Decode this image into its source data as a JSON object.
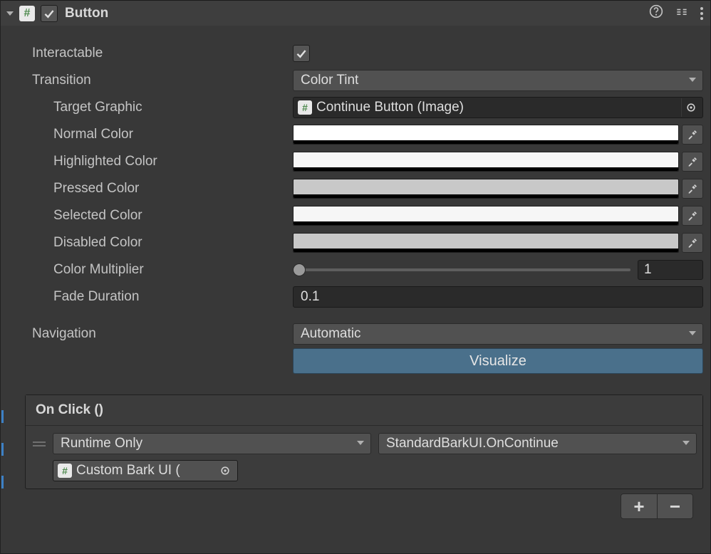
{
  "header": {
    "title": "Button",
    "enabled": true
  },
  "icons": {
    "help": "help-icon",
    "preset": "preset-icon",
    "menu": "kebab-icon"
  },
  "fields": {
    "interactable_label": "Interactable",
    "interactable_checked": true,
    "transition_label": "Transition",
    "transition_value": "Color Tint",
    "target_graphic_label": "Target Graphic",
    "target_graphic_value": "Continue Button (Image)",
    "normal_color_label": "Normal Color",
    "highlighted_color_label": "Highlighted Color",
    "pressed_color_label": "Pressed Color",
    "selected_color_label": "Selected Color",
    "disabled_color_label": "Disabled Color",
    "colors": {
      "normal": {
        "hex": "#ffffff",
        "alpha": 1.0
      },
      "highlighted": {
        "hex": "#f6f6f6",
        "alpha": 1.0
      },
      "pressed": {
        "hex": "#c8c8c8",
        "alpha": 1.0
      },
      "selected": {
        "hex": "#f6f6f6",
        "alpha": 1.0
      },
      "disabled": {
        "hex": "#c8c8c8",
        "alpha": 0.5
      }
    },
    "color_multiplier_label": "Color Multiplier",
    "color_multiplier_value": "1",
    "color_multiplier_slider_pct": 0,
    "fade_duration_label": "Fade Duration",
    "fade_duration_value": "0.1",
    "navigation_label": "Navigation",
    "navigation_value": "Automatic",
    "visualize_label": "Visualize"
  },
  "event": {
    "title": "On Click ()",
    "call_state": "Runtime Only",
    "method": "StandardBarkUI.OnContinue",
    "target_object": "Custom Bark UI ("
  }
}
